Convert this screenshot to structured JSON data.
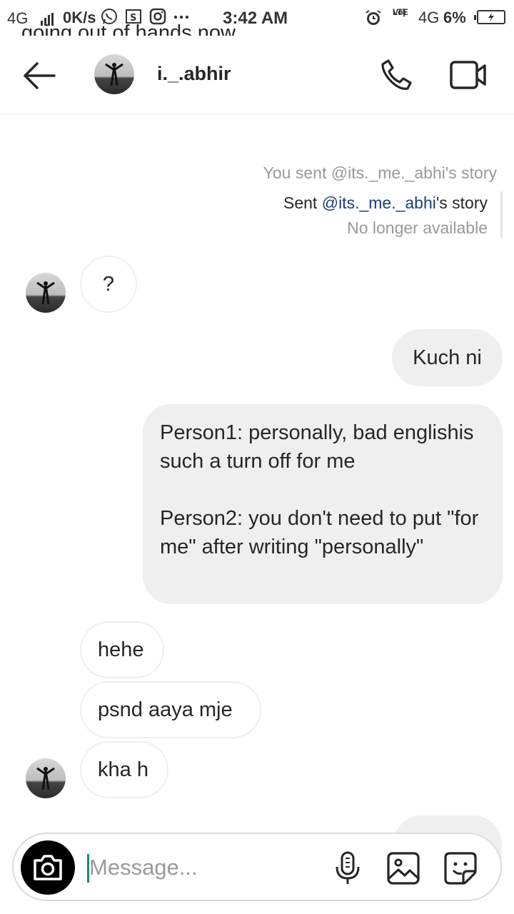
{
  "status_bar": {
    "network": "4G",
    "speed": "0K/s",
    "time": "3:42 AM",
    "volte_top": "Vo)",
    "volte_bottom": "LTE",
    "network2": "4G",
    "battery": "6%",
    "battery_level": 0.06
  },
  "header": {
    "username": "i._.abhir"
  },
  "thread": {
    "partial_message": "going out of hands now",
    "story_note": "You sent @its._me._abhi's story",
    "story_sent_prefix": "Sent ",
    "story_mention": "@its._me._abhi",
    "story_sent_suffix": "'s story",
    "story_unavailable": "No longer available",
    "messages": [
      {
        "side": "in",
        "text": "?"
      },
      {
        "side": "out",
        "text": "Kuch ni"
      },
      {
        "side": "out",
        "text": "Person1: personally, bad englishis such a turn off for me\n\nPerson2: you don't need to put \"for me\" after writing \"personally\""
      },
      {
        "side": "in",
        "text": "hehe"
      },
      {
        "side": "in",
        "text": "psnd aaya mje"
      },
      {
        "side": "in",
        "text": "kha h"
      }
    ]
  },
  "composer": {
    "placeholder": "Message..."
  },
  "colors": {
    "outgoing_bubble": "#efefef",
    "incoming_border": "#efefef",
    "mention": "#1b3f73",
    "caret": "#178a7a"
  }
}
